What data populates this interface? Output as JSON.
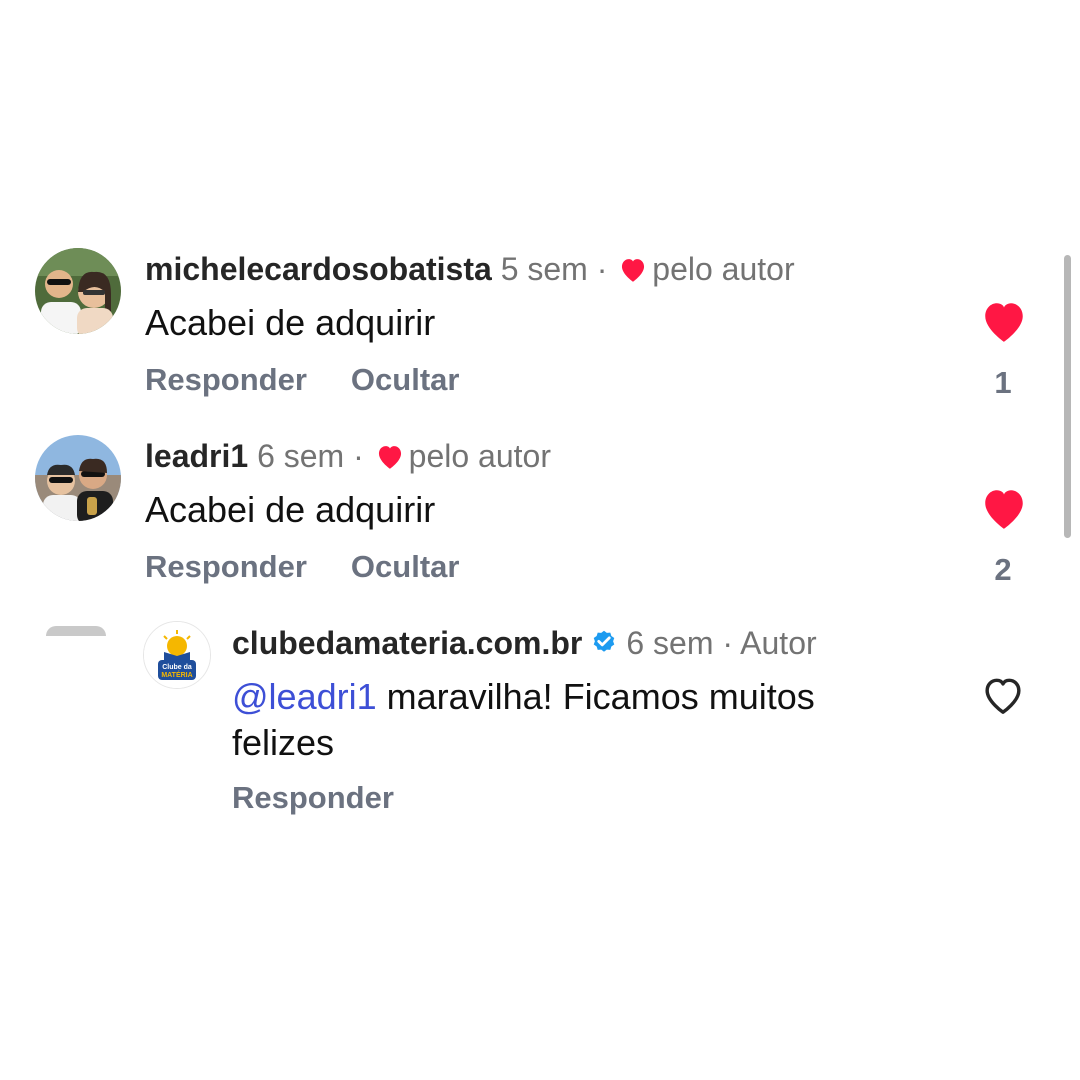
{
  "comments": [
    {
      "username": "michelecardosobatista",
      "time": "5 sem",
      "separator": "·",
      "liked_by_author": "pelo autor",
      "text": "Acabei de adquirir",
      "actions": {
        "reply": "Responder",
        "hide": "Ocultar"
      },
      "likes": "1",
      "liked": true
    },
    {
      "username": "leadri1",
      "time": "6 sem",
      "separator": "·",
      "liked_by_author": "pelo autor",
      "text": "Acabei de adquirir",
      "actions": {
        "reply": "Responder",
        "hide": "Ocultar"
      },
      "likes": "2",
      "liked": true
    }
  ],
  "reply": {
    "username": "clubedamateria.com.br",
    "verified": true,
    "time": "6 sem",
    "separator": "·",
    "author_label": "Autor",
    "mention": "@leadri1",
    "text_line1": " maravilha! Ficamos muitos",
    "text_line2": "felizes",
    "actions": {
      "reply": "Responder"
    },
    "liked": false,
    "avatar_logo_line1": "Clube da",
    "avatar_logo_line2": "MATÉRIA"
  },
  "colors": {
    "heart_red": "#ff1744",
    "verified_blue": "#1d9bf0",
    "mention_blue": "#3d4fd6",
    "secondary_text": "#737373",
    "action_gray": "#6b7280"
  },
  "icons": {
    "like_filled": "heart-icon",
    "like_outline": "heart-outline-icon",
    "author_like": "heart-icon",
    "verified": "verified-badge-icon"
  }
}
